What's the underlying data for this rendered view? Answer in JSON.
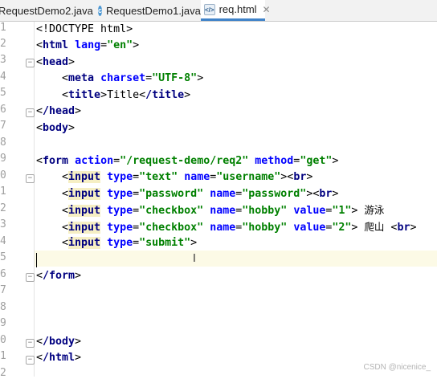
{
  "tabs": [
    {
      "label": "RequestDemo2.java",
      "icon": "java-class-icon",
      "active": false
    },
    {
      "label": "RequestDemo1.java",
      "icon": "java-class-icon",
      "active": false
    },
    {
      "label": "req.html",
      "icon": "html-file-icon",
      "active": true
    }
  ],
  "editor": {
    "line_numbers": [
      "1",
      "2",
      "3",
      "4",
      "5",
      "6",
      "7",
      "8",
      "9",
      "0",
      "1",
      "2",
      "3",
      "4",
      "5",
      "6",
      "7",
      "8",
      "9",
      "0",
      "1",
      "2"
    ],
    "code": {
      "doctype": "<!DOCTYPE html>",
      "l2_open": "<",
      "l2_tag": "html",
      "l2_attr": "lang",
      "l2_eq": "=",
      "l2_val": "\"en\"",
      "l2_close": ">",
      "l3": "head",
      "l4_tag": "meta",
      "l4_attr": "charset",
      "l4_val": "\"UTF-8\"",
      "l5_tag": "title",
      "l5_text": "Title",
      "l5_end": "/title",
      "l6": "/head",
      "l7": "body",
      "l9_tag": "form",
      "l9_a1": "action",
      "l9_v1": "\"/request-demo/req2\"",
      "l9_a2": "method",
      "l9_v2": "\"get\"",
      "input": "input",
      "type": "type",
      "name": "name",
      "value": "value",
      "l10_type": "\"text\"",
      "l10_name": "\"username\"",
      "l11_type": "\"password\"",
      "l11_name": "\"password\"",
      "l12_type": "\"checkbox\"",
      "l12_name": "\"hobby\"",
      "l12_val": "\"1\"",
      "l12_text": "游泳",
      "l13_type": "\"checkbox\"",
      "l13_name": "\"hobby\"",
      "l13_val": "\"2\"",
      "l13_text": "爬山",
      "l14_type": "\"submit\"",
      "br": "br",
      "l17": "/form",
      "l21": "/body",
      "l22": "/html"
    }
  },
  "watermark": "CSDN @nicenice_"
}
